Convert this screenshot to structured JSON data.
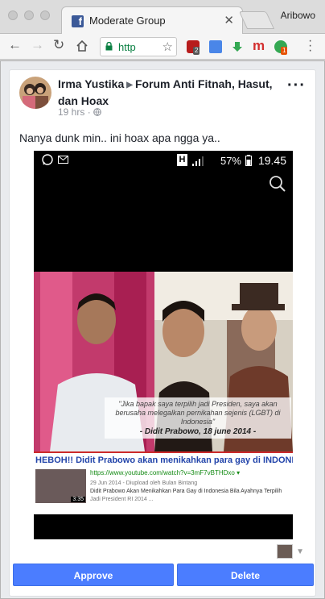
{
  "browser": {
    "tab_title": "Moderate Group",
    "tab_close_glyph": "✕",
    "profile_name": "Aribowo",
    "url_display": "http",
    "ext_badge_1": "2",
    "ext_badge_2": "1",
    "ext_m_label": "m",
    "icons": [
      "back-icon",
      "forward-icon",
      "reload-icon",
      "home-icon",
      "lock-icon",
      "star-icon",
      "menu-icon"
    ]
  },
  "post": {
    "author": "Irma Yustika",
    "group": "Forum Anti Fitnah, Hasut, dan Hoax",
    "time": "19 hrs",
    "time_separator": "·",
    "message": "Nanya dunk min.. ini hoax apa ngga ya..",
    "screenshot": {
      "battery": "57%",
      "clock": "19.45",
      "h_indicator": "H",
      "quote": "\"Jika bapak saya terpilih jadi Presiden, saya akan berusaha melegalkan pernikahan sejenis (LGBT) di Indonesia\"",
      "quote_signature": "- Didit Prabowo, 18 june 2014 -",
      "video_title": "HEBOH!! Didit Prabowo akan menikahkan para gay di INDONESIA ...",
      "video_url": "https://www.youtube.com/watch?v=3mF7vBTHDxo ▾",
      "video_date": "29 Jun 2014 - Diupload oleh Bulan Bintang",
      "video_desc_1": "Didit Prabowo Akan Menikahkan Para Gay di Indonesia Bila Ayahnya Terpilih",
      "video_desc_2": "Jadi President RI 2014 ...",
      "video_duration": "3:35"
    }
  },
  "actions": {
    "approve": "Approve",
    "delete": "Delete"
  },
  "colors": {
    "facebook_blue": "#3b5998",
    "button_blue": "#4b7dff",
    "secure_green": "#0b8043"
  }
}
